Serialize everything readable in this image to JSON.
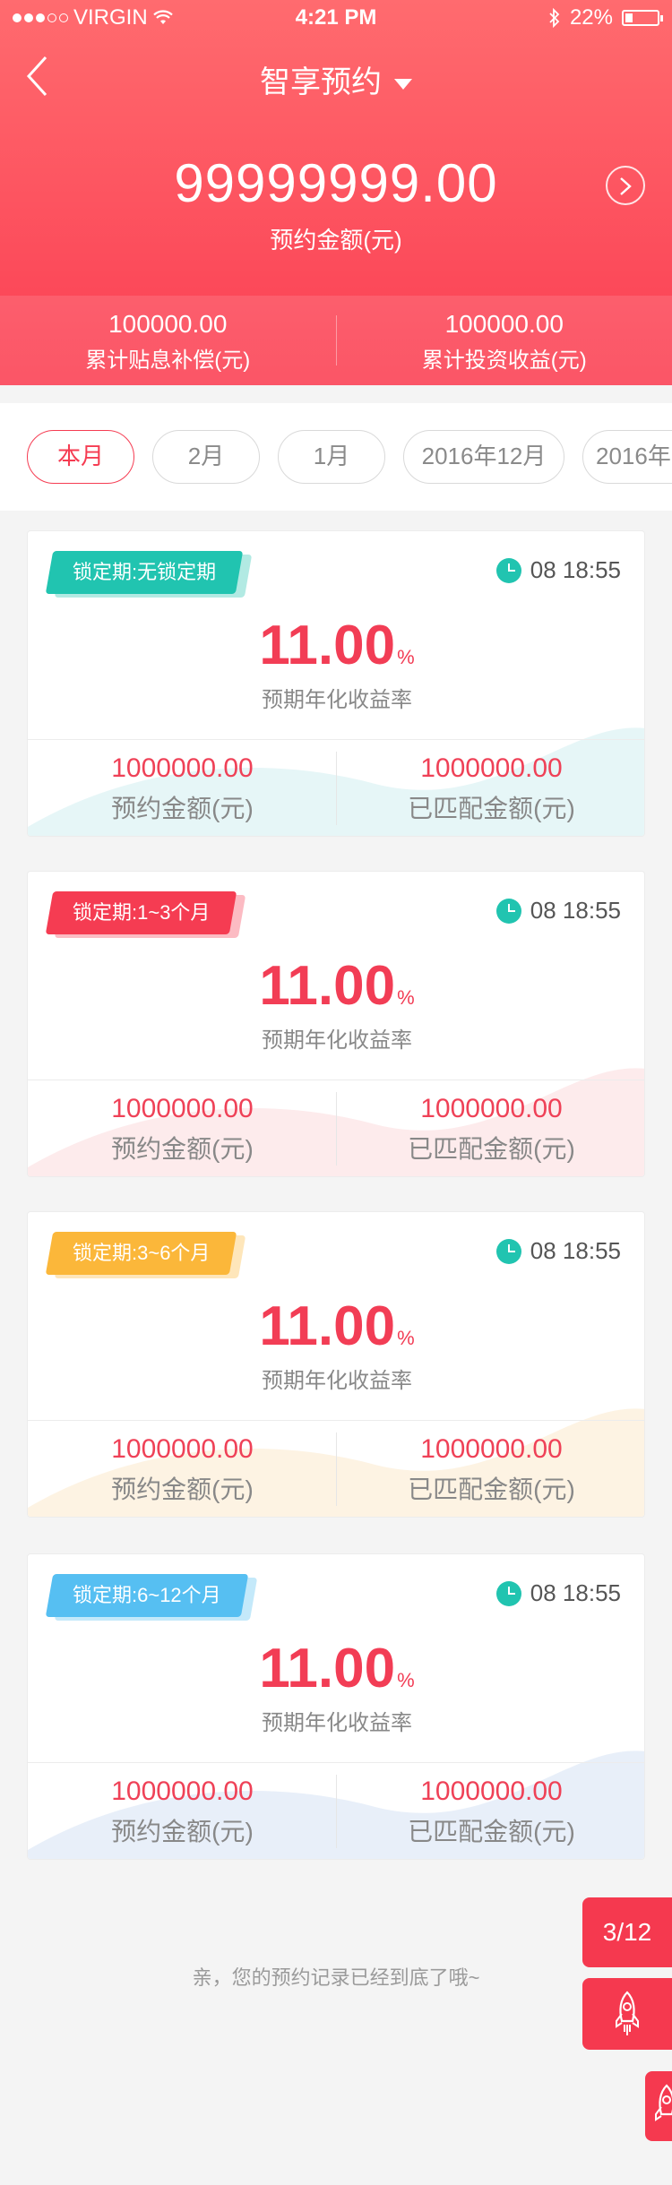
{
  "status_bar": {
    "carrier": "VIRGIN",
    "time": "4:21 PM",
    "battery": "22%"
  },
  "nav": {
    "title": "智享预约"
  },
  "summary": {
    "amount": "99999999.00",
    "amount_label": "预约金额(元)",
    "stats": [
      {
        "value": "100000.00",
        "label": "累计贴息补偿(元)"
      },
      {
        "value": "100000.00",
        "label": "累计投资收益(元)"
      }
    ]
  },
  "tabs": [
    "本月",
    "2月",
    "1月",
    "2016年12月",
    "2016年"
  ],
  "cards": [
    {
      "lock": "锁定期:无锁定期",
      "badge_color": "#21c4b0",
      "wave_color": "#e6f6f7",
      "time": "08 18:55",
      "rate": "11.00",
      "rate_unit": "%",
      "rate_label": "预期年化收益率",
      "left_value": "1000000.00",
      "left_label": "预约金额(元)",
      "right_value": "1000000.00",
      "right_label": "已匹配金额(元)"
    },
    {
      "lock": "锁定期:1~3个月",
      "badge_color": "#f53c52",
      "wave_color": "#fdebec",
      "time": "08 18:55",
      "rate": "11.00",
      "rate_unit": "%",
      "rate_label": "预期年化收益率",
      "left_value": "1000000.00",
      "left_label": "预约金额(元)",
      "right_value": "1000000.00",
      "right_label": "已匹配金额(元)"
    },
    {
      "lock": "锁定期:3~6个月",
      "badge_color": "#fbb73a",
      "wave_color": "#fdf3e3",
      "time": "08 18:55",
      "rate": "11.00",
      "rate_unit": "%",
      "rate_label": "预期年化收益率",
      "left_value": "1000000.00",
      "left_label": "预约金额(元)",
      "right_value": "1000000.00",
      "right_label": "已匹配金额(元)"
    },
    {
      "lock": "锁定期:6~12个月",
      "badge_color": "#56bff2",
      "wave_color": "#e8eff9",
      "time": "08 18:55",
      "rate": "11.00",
      "rate_unit": "%",
      "rate_label": "预期年化收益率",
      "left_value": "1000000.00",
      "left_label": "预约金额(元)",
      "right_value": "1000000.00",
      "right_label": "已匹配金额(元)"
    }
  ],
  "footer": {
    "end_text": "亲，您的预约记录已经到底了哦~"
  },
  "float": {
    "page_indicator": "3/12"
  }
}
